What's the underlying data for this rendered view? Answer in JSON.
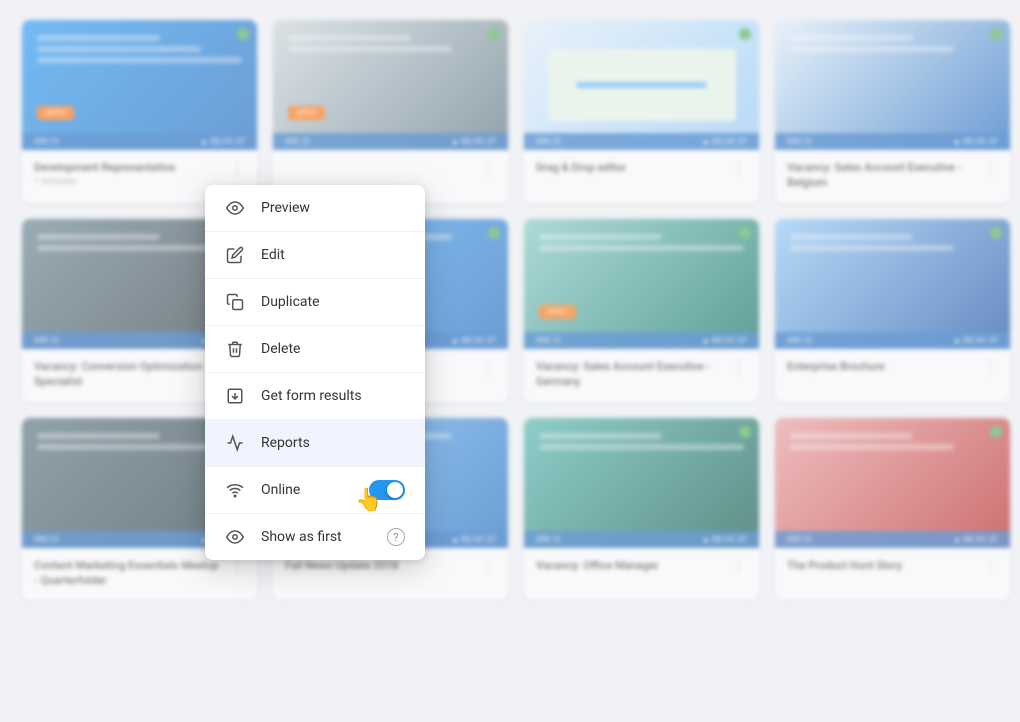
{
  "menu": {
    "items": [
      {
        "id": "preview",
        "label": "Preview",
        "icon": "eye"
      },
      {
        "id": "edit",
        "label": "Edit",
        "icon": "pencil"
      },
      {
        "id": "duplicate",
        "label": "Duplicate",
        "icon": "copy"
      },
      {
        "id": "delete",
        "label": "Delete",
        "icon": "trash"
      },
      {
        "id": "get-form-results",
        "label": "Get form results",
        "icon": "download-box"
      },
      {
        "id": "reports",
        "label": "Reports",
        "icon": "chart-line",
        "active": true
      },
      {
        "id": "online",
        "label": "Online",
        "icon": "wifi",
        "toggle": true,
        "toggle_on": true
      },
      {
        "id": "show-as-first",
        "label": "Show as first",
        "icon": "eye2",
        "help": true
      }
    ]
  },
  "cards": [
    {
      "id": 1,
      "title": "Development Representative",
      "subtitle": "1 template",
      "color": "blue",
      "has_green_dot": true,
      "has_orange_btn": true
    },
    {
      "id": 2,
      "title": "",
      "subtitle": "",
      "color": "photo2",
      "has_green_dot": true,
      "has_orange_btn": true
    },
    {
      "id": 3,
      "title": "Drag & Drop editor",
      "subtitle": "",
      "color": "teal",
      "has_green_dot": true
    },
    {
      "id": 4,
      "title": "Vacancy: Sales Account Executive - Belgium",
      "subtitle": "",
      "color": "photo1",
      "has_green_dot": true
    },
    {
      "id": 5,
      "title": "",
      "subtitle": "",
      "color": "dark",
      "has_green_dot": false
    },
    {
      "id": 6,
      "title": "",
      "subtitle": "",
      "color": "blue",
      "has_green_dot": true
    },
    {
      "id": 7,
      "title": "Vacancy: Sales Account Executive - Germany",
      "subtitle": "",
      "color": "photo3",
      "has_green_dot": true
    },
    {
      "id": 8,
      "title": "Enterprise Brochure",
      "subtitle": "",
      "color": "photo1",
      "has_green_dot": true
    },
    {
      "id": 9,
      "title": "Content Marketing Essentials Meetup - Quarterfolder",
      "subtitle": "",
      "color": "dark",
      "has_green_dot": false
    },
    {
      "id": 10,
      "title": "Fall News Update 2018",
      "subtitle": "",
      "color": "blue",
      "has_green_dot": false
    },
    {
      "id": 11,
      "title": "Vacancy: Office Manager",
      "subtitle": "",
      "color": "photo3",
      "has_green_dot": true
    },
    {
      "id": 12,
      "title": "The Product Hunt Story",
      "subtitle": "",
      "color": "photo1",
      "has_green_dot": true
    }
  ],
  "colors": {
    "menu_active_bg": "#f0f4ff",
    "toggle_color": "#2196F3",
    "green_dot": "#4CAF50",
    "orange_btn": "#FF6F00"
  }
}
